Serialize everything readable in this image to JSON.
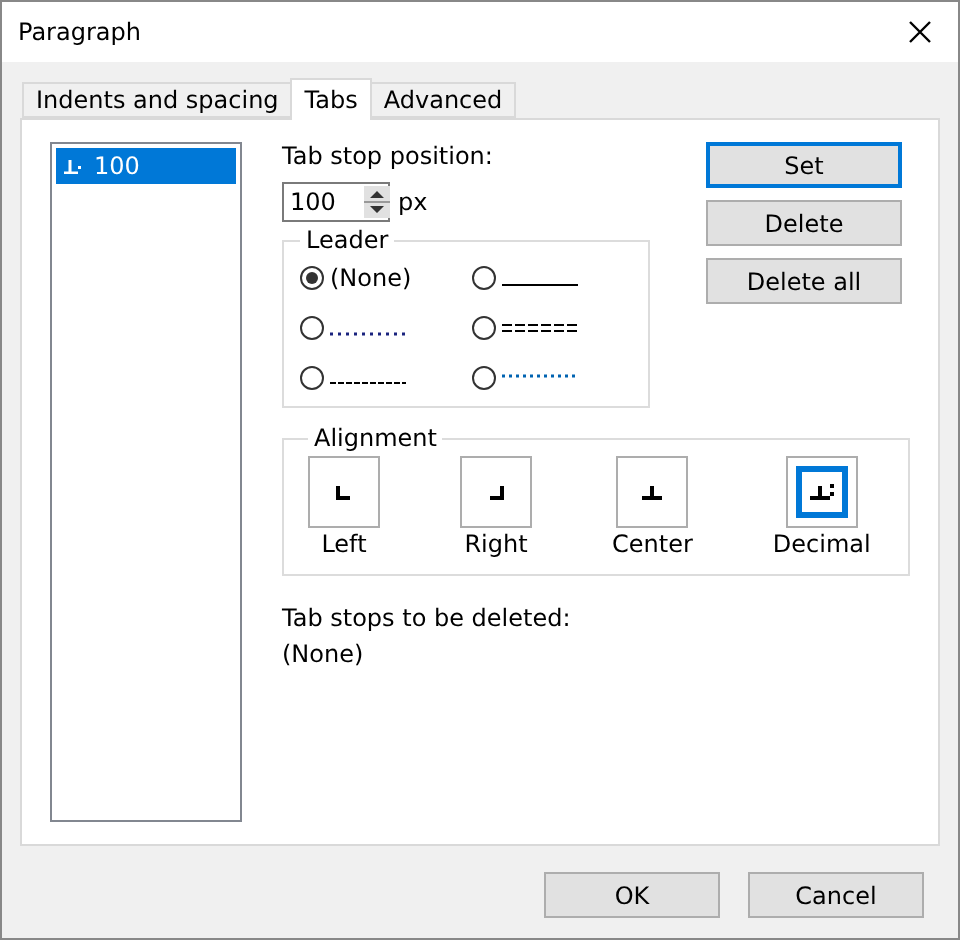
{
  "window": {
    "title": "Paragraph"
  },
  "tabs": [
    {
      "label": "Indents and spacing",
      "selected": false
    },
    {
      "label": "Tabs",
      "selected": true
    },
    {
      "label": "Advanced",
      "selected": false
    }
  ],
  "tab_stops": [
    {
      "label": "100",
      "selected": true
    }
  ],
  "position": {
    "label": "Tab stop position:",
    "value": "100",
    "unit": "px"
  },
  "leader": {
    "title": "Leader",
    "options": [
      {
        "kind": "none",
        "label": "(None)",
        "selected": true
      },
      {
        "kind": "solid",
        "selected": false
      },
      {
        "kind": "dotted",
        "selected": false
      },
      {
        "kind": "double",
        "selected": false
      },
      {
        "kind": "dashed",
        "selected": false
      },
      {
        "kind": "fine-dotted",
        "selected": false
      }
    ]
  },
  "side_buttons": [
    {
      "label": "Set",
      "focused": true
    },
    {
      "label": "Delete",
      "focused": false
    },
    {
      "label": "Delete all",
      "focused": false
    }
  ],
  "alignment": {
    "title": "Alignment",
    "options": [
      {
        "kind": "left",
        "label": "Left",
        "selected": false
      },
      {
        "kind": "right",
        "label": "Right",
        "selected": false
      },
      {
        "kind": "center",
        "label": "Center",
        "selected": false
      },
      {
        "kind": "decimal",
        "label": "Decimal",
        "selected": true
      }
    ]
  },
  "to_delete": {
    "label": "Tab stops to be deleted:",
    "value": "(None)"
  },
  "buttons": [
    {
      "label": "OK"
    },
    {
      "label": "Cancel"
    }
  ]
}
